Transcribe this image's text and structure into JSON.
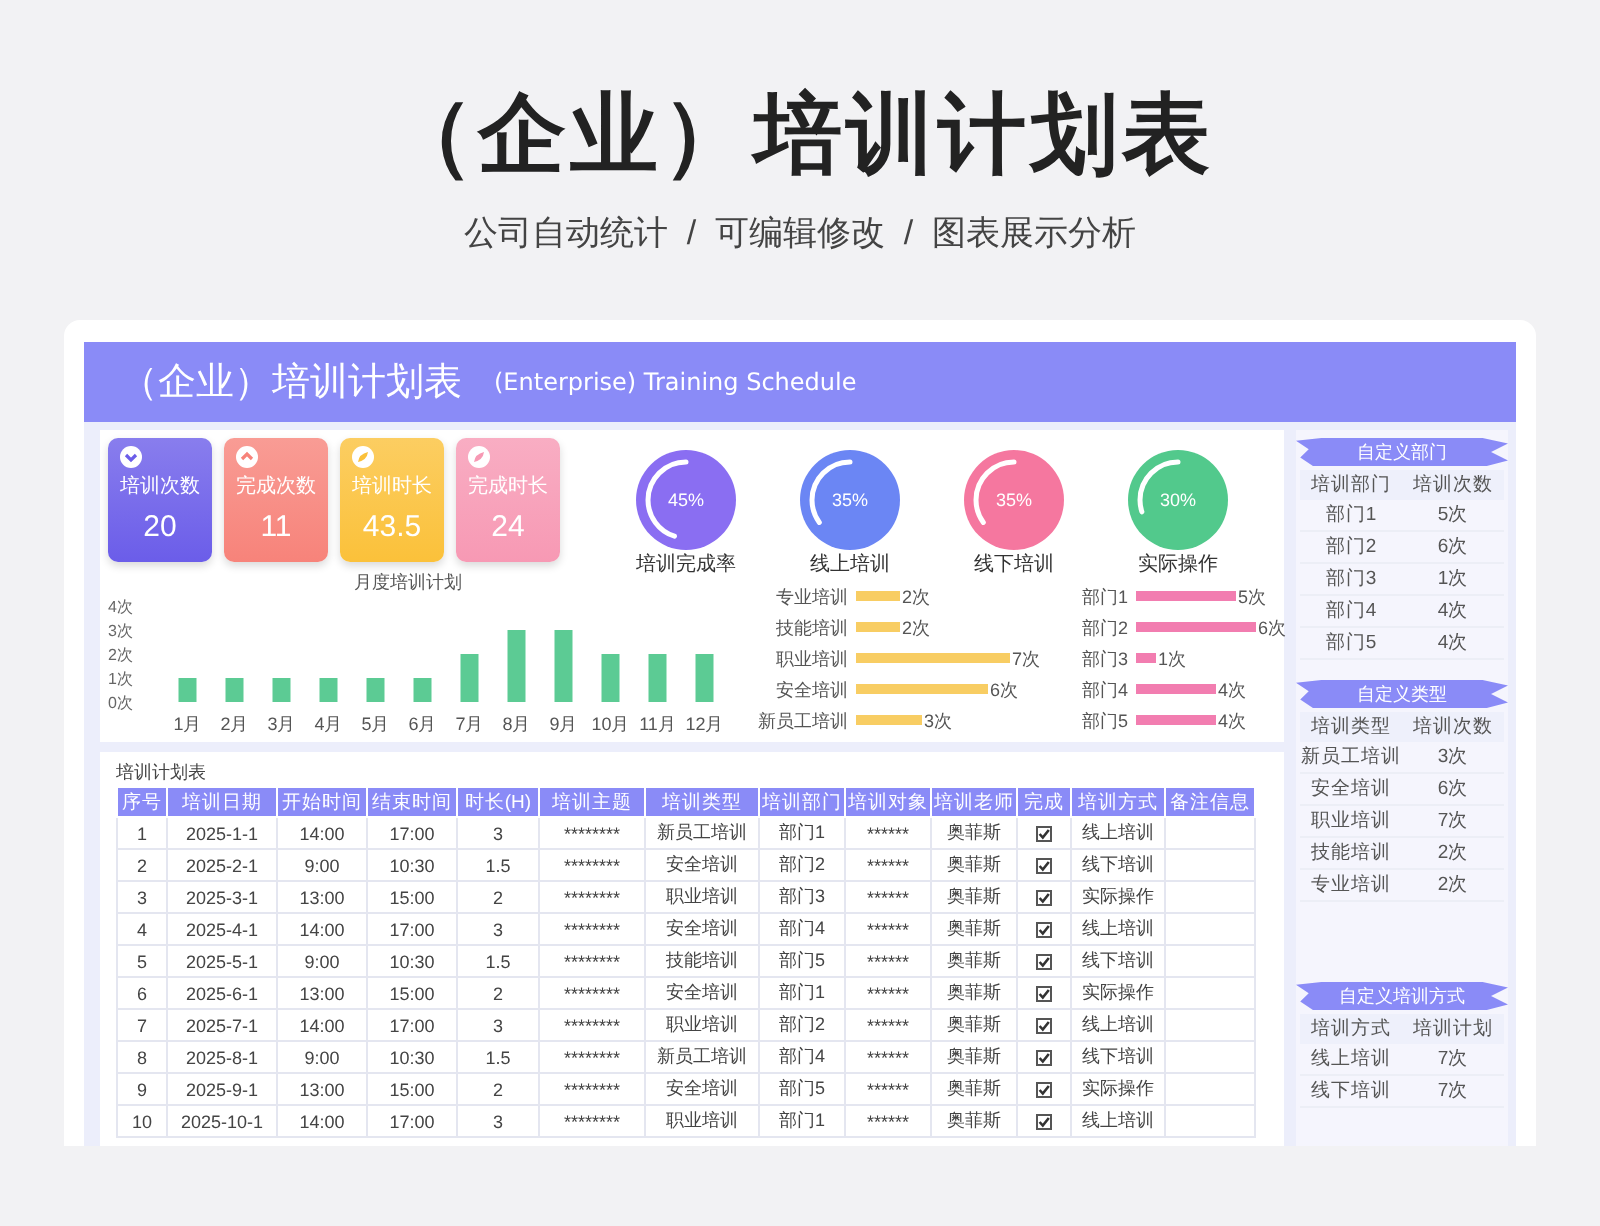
{
  "page": {
    "title": "（企业）培训计划表",
    "subtitle": "公司自动统计  /  可编辑修改  /  图表展示分析"
  },
  "sheet": {
    "title": "（企业）培训计划表",
    "subtitle": "(Enterprise) Training Schedule"
  },
  "kpis": [
    {
      "label": "培训次数",
      "value": "20",
      "color": "#6b5de9"
    },
    {
      "label": "完成次数",
      "value": "11",
      "color": "#f7837a"
    },
    {
      "label": "培训时长",
      "value": "43.5",
      "color": "#fbc13a"
    },
    {
      "label": "完成时长",
      "value": "24",
      "color": "#f799b4"
    }
  ],
  "rings": [
    {
      "label": "培训完成率",
      "reading": "45%",
      "level": 0.45,
      "color": "#8a6ef2"
    },
    {
      "label": "线上培训",
      "reading": "35%",
      "level": 0.35,
      "color": "#6b86f4"
    },
    {
      "label": "线下培训",
      "reading": "35%",
      "level": 0.35,
      "color": "#f5779f"
    },
    {
      "label": "实际操作",
      "reading": "30%",
      "level": 0.3,
      "color": "#52c98c"
    }
  ],
  "monthly_chart": {
    "chart_data": {
      "type": "bar",
      "title": "月度培训计划",
      "categories": [
        "1月",
        "2月",
        "3月",
        "4月",
        "5月",
        "6月",
        "7月",
        "8月",
        "9月",
        "10月",
        "11月",
        "12月"
      ],
      "series": [
        {
          "color": "#5ccb94",
          "values": [
            1,
            1,
            1,
            1,
            1,
            1,
            2,
            3,
            3,
            2,
            2,
            2
          ]
        }
      ],
      "ylim": [
        0,
        4
      ],
      "yticks": [
        {
          "value": 0,
          "label": "0次"
        },
        {
          "value": 1,
          "label": "1次"
        },
        {
          "value": 2,
          "label": "2次"
        },
        {
          "value": 3,
          "label": "3次"
        },
        {
          "value": 4,
          "label": "4次"
        }
      ]
    }
  },
  "type_chart": {
    "unit_labels": [
      "次",
      "次",
      "次",
      "次",
      "次"
    ],
    "chart_data": {
      "type": "bar",
      "orientation": "horizontal",
      "categories": [
        "专业培训",
        "技能培训",
        "职业培训",
        "安全培训",
        "新员工培训"
      ],
      "series": [
        {
          "color": "#f8cd63",
          "values": [
            2,
            2,
            7,
            6,
            3
          ]
        }
      ],
      "data_labels": true
    }
  },
  "dept_chart": {
    "unit_labels": [
      "次",
      "次",
      "次",
      "次",
      "次"
    ],
    "chart_data": {
      "type": "bar",
      "orientation": "horizontal",
      "categories": [
        "部门1",
        "部门2",
        "部门3",
        "部门4",
        "部门5"
      ],
      "series": [
        {
          "color": "#f27db0",
          "values": [
            5,
            6,
            1,
            4,
            4
          ]
        }
      ],
      "data_labels": true
    }
  },
  "schedule": {
    "title": "培训计划表",
    "columns": [
      "序号",
      "培训日期",
      "开始时间",
      "结束时间",
      "时长(H)",
      "培训主题",
      "培训类型",
      "培训部门",
      "培训对象",
      "培训老师",
      "完成",
      "培训方式",
      "备注信息"
    ],
    "rows": [
      {
        "no": "1",
        "date": "2025-1-1",
        "start": "14:00",
        "end": "17:00",
        "hours": "3",
        "topic": "********",
        "type": "新员工培训",
        "dept": "部门1",
        "target": "******",
        "teacher": "奥菲斯",
        "done": true,
        "method": "线上培训"
      },
      {
        "no": "2",
        "date": "2025-2-1",
        "start": "9:00",
        "end": "10:30",
        "hours": "1.5",
        "topic": "********",
        "type": "安全培训",
        "dept": "部门2",
        "target": "******",
        "teacher": "奥菲斯",
        "done": true,
        "method": "线下培训"
      },
      {
        "no": "3",
        "date": "2025-3-1",
        "start": "13:00",
        "end": "15:00",
        "hours": "2",
        "topic": "********",
        "type": "职业培训",
        "dept": "部门3",
        "target": "******",
        "teacher": "奥菲斯",
        "done": true,
        "method": "实际操作"
      },
      {
        "no": "4",
        "date": "2025-4-1",
        "start": "14:00",
        "end": "17:00",
        "hours": "3",
        "topic": "********",
        "type": "安全培训",
        "dept": "部门4",
        "target": "******",
        "teacher": "奥菲斯",
        "done": true,
        "method": "线上培训"
      },
      {
        "no": "5",
        "date": "2025-5-1",
        "start": "9:00",
        "end": "10:30",
        "hours": "1.5",
        "topic": "********",
        "type": "技能培训",
        "dept": "部门5",
        "target": "******",
        "teacher": "奥菲斯",
        "done": true,
        "method": "线下培训"
      },
      {
        "no": "6",
        "date": "2025-6-1",
        "start": "13:00",
        "end": "15:00",
        "hours": "2",
        "topic": "********",
        "type": "安全培训",
        "dept": "部门1",
        "target": "******",
        "teacher": "奥菲斯",
        "done": true,
        "method": "实际操作"
      },
      {
        "no": "7",
        "date": "2025-7-1",
        "start": "14:00",
        "end": "17:00",
        "hours": "3",
        "topic": "********",
        "type": "职业培训",
        "dept": "部门2",
        "target": "******",
        "teacher": "奥菲斯",
        "done": true,
        "method": "线上培训"
      },
      {
        "no": "8",
        "date": "2025-8-1",
        "start": "9:00",
        "end": "10:30",
        "hours": "1.5",
        "topic": "********",
        "type": "新员工培训",
        "dept": "部门4",
        "target": "******",
        "teacher": "奥菲斯",
        "done": true,
        "method": "线下培训"
      },
      {
        "no": "9",
        "date": "2025-9-1",
        "start": "13:00",
        "end": "15:00",
        "hours": "2",
        "topic": "********",
        "type": "安全培训",
        "dept": "部门5",
        "target": "******",
        "teacher": "奥菲斯",
        "done": true,
        "method": "实际操作"
      },
      {
        "no": "10",
        "date": "2025-10-1",
        "start": "14:00",
        "end": "17:00",
        "hours": "3",
        "topic": "********",
        "type": "职业培训",
        "dept": "部门1",
        "target": "******",
        "teacher": "奥菲斯",
        "done": true,
        "method": "线上培训"
      }
    ]
  },
  "side_tables": [
    {
      "title": "自定义部门",
      "columns": [
        "培训部门",
        "培训次数"
      ],
      "rows": [
        [
          "部门1",
          "5次"
        ],
        [
          "部门2",
          "6次"
        ],
        [
          "部门3",
          "1次"
        ],
        [
          "部门4",
          "4次"
        ],
        [
          "部门5",
          "4次"
        ]
      ]
    },
    {
      "title": "自定义类型",
      "columns": [
        "培训类型",
        "培训次数"
      ],
      "rows": [
        [
          "新员工培训",
          "3次"
        ],
        [
          "安全培训",
          "6次"
        ],
        [
          "职业培训",
          "7次"
        ],
        [
          "技能培训",
          "2次"
        ],
        [
          "专业培训",
          "2次"
        ]
      ]
    },
    {
      "title": "自定义培训方式",
      "columns": [
        "培训方式",
        "培训计划"
      ],
      "rows": [
        [
          "线上培训",
          "7次"
        ],
        [
          "线下培训",
          "7次"
        ]
      ]
    }
  ]
}
